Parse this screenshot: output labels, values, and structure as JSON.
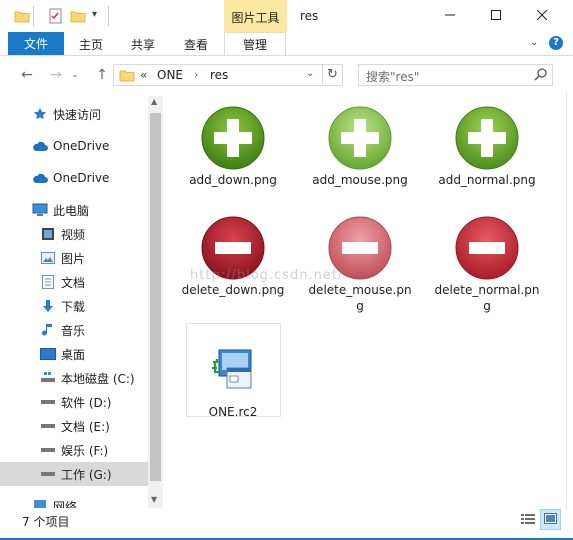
{
  "titlebar": {
    "context_tab": "图片工具",
    "window_title": "res"
  },
  "ribbon": {
    "file": "文件",
    "home": "主页",
    "share": "共享",
    "view": "查看",
    "manage": "管理"
  },
  "address": {
    "overflow": "«",
    "segments": [
      "ONE",
      "res"
    ]
  },
  "search": {
    "placeholder": "搜索\"res\""
  },
  "sidebar": {
    "items": [
      {
        "label": "快速访问",
        "icon": "star-icon"
      },
      {
        "label": "OneDrive",
        "icon": "cloud-icon"
      },
      {
        "label": "OneDrive",
        "icon": "cloud-icon"
      },
      {
        "label": "此电脑",
        "icon": "computer-icon"
      },
      {
        "label": "视频",
        "icon": "video-icon"
      },
      {
        "label": "图片",
        "icon": "picture-icon"
      },
      {
        "label": "文档",
        "icon": "document-icon"
      },
      {
        "label": "下载",
        "icon": "download-icon"
      },
      {
        "label": "音乐",
        "icon": "music-icon"
      },
      {
        "label": "桌面",
        "icon": "desktop-icon"
      },
      {
        "label": "本地磁盘 (C:)",
        "icon": "drive-icon"
      },
      {
        "label": "软件 (D:)",
        "icon": "drive-icon"
      },
      {
        "label": "文档 (E:)",
        "icon": "drive-icon"
      },
      {
        "label": "娱乐 (F:)",
        "icon": "drive-icon"
      },
      {
        "label": "工作 (G:)",
        "icon": "drive-icon"
      },
      {
        "label": "网络",
        "icon": "network-icon"
      }
    ],
    "selected_index": 14
  },
  "files": [
    {
      "name": "add_down.png",
      "type": "add",
      "state": "down"
    },
    {
      "name": "add_mouse.png",
      "type": "add",
      "state": "mouse"
    },
    {
      "name": "add_normal.png",
      "type": "add",
      "state": "normal"
    },
    {
      "name": "delete_down.png",
      "type": "delete",
      "state": "down"
    },
    {
      "name": "delete_mouse.png",
      "type": "delete",
      "state": "mouse"
    },
    {
      "name": "delete_normal.png",
      "type": "delete",
      "state": "normal"
    },
    {
      "name": "ONE.rc2",
      "type": "rc2",
      "state": ""
    }
  ],
  "watermark": "http://blog.csdn.net/",
  "status": {
    "item_count": "7 个项目"
  },
  "colors": {
    "accent": "#1979ca",
    "context_tab": "#fbe8a3",
    "selected": "#cce8ff",
    "selected_sidebar": "#d9d9d9"
  }
}
